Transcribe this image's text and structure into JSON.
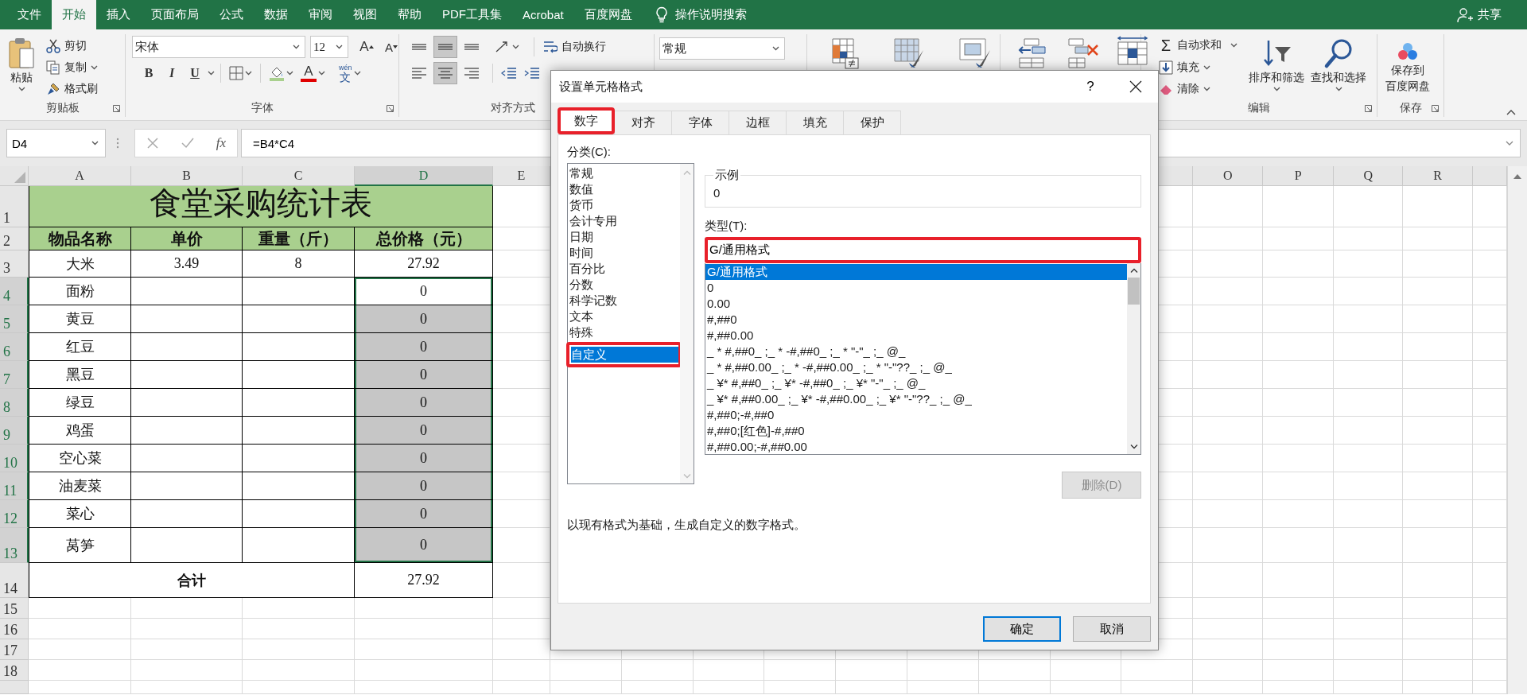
{
  "ribbon_tabs": [
    {
      "label": "文件",
      "selected": false
    },
    {
      "label": "开始",
      "selected": true
    },
    {
      "label": "插入",
      "selected": false
    },
    {
      "label": "页面布局",
      "selected": false
    },
    {
      "label": "公式",
      "selected": false
    },
    {
      "label": "数据",
      "selected": false
    },
    {
      "label": "审阅",
      "selected": false
    },
    {
      "label": "视图",
      "selected": false
    },
    {
      "label": "帮助",
      "selected": false
    },
    {
      "label": "PDF工具集",
      "selected": false
    },
    {
      "label": "Acrobat",
      "selected": false
    },
    {
      "label": "百度网盘",
      "selected": false
    }
  ],
  "tell_me": "操作说明搜索",
  "share": "共享",
  "clipboard": {
    "paste": "粘贴",
    "cut": "剪切",
    "copy": "复制",
    "format_painter": "格式刷",
    "label": "剪贴板"
  },
  "font": {
    "name": "宋体",
    "size": "12",
    "grow": "A",
    "shrink": "A",
    "bold": "B",
    "italic": "I",
    "underline": "U",
    "color_letter": "A",
    "phonetic_top": "wén",
    "phonetic": "文",
    "label": "字体"
  },
  "alignment": {
    "vertical_buttons": [
      {
        "selected": false
      },
      {
        "selected": true
      },
      {
        "selected": false
      }
    ],
    "horizontal_buttons": [
      {
        "selected": false
      },
      {
        "selected": true
      },
      {
        "selected": false
      }
    ],
    "wrap_text": "自动换行",
    "label": "对齐方式"
  },
  "number": {
    "format": "常规"
  },
  "editing": {
    "sigma": "Σ",
    "autosum": "自动求和",
    "fill": "填充",
    "clear": "清除",
    "sort_filter": "排序和筛选",
    "find_select": "查找和选择",
    "label": "编辑"
  },
  "save": {
    "lines": [
      "保存到",
      "百度网盘"
    ],
    "label": "保存"
  },
  "formula_bar": {
    "name_box": "D4",
    "fx": "fx",
    "formula": "=B4*C4"
  },
  "sheet": {
    "column_headers": [
      {
        "label": "A",
        "selected": false
      },
      {
        "label": "B",
        "selected": false
      },
      {
        "label": "C",
        "selected": false
      },
      {
        "label": "D",
        "selected": true
      },
      {
        "label": "E",
        "selected": false
      },
      {
        "label": "O",
        "selected": false
      },
      {
        "label": "P",
        "selected": false
      },
      {
        "label": "Q",
        "selected": false
      },
      {
        "label": "R",
        "selected": false
      }
    ],
    "row_headers": [
      {
        "label": "1",
        "selected": false
      },
      {
        "label": "2",
        "selected": false
      },
      {
        "label": "3",
        "selected": false
      },
      {
        "label": "4",
        "selected": true
      },
      {
        "label": "5",
        "selected": true
      },
      {
        "label": "6",
        "selected": true
      },
      {
        "label": "7",
        "selected": true
      },
      {
        "label": "8",
        "selected": true
      },
      {
        "label": "9",
        "selected": true
      },
      {
        "label": "10",
        "selected": true
      },
      {
        "label": "11",
        "selected": true
      },
      {
        "label": "12",
        "selected": true
      },
      {
        "label": "13",
        "selected": true
      },
      {
        "label": "14",
        "selected": false
      },
      {
        "label": "15",
        "selected": false
      },
      {
        "label": "16",
        "selected": false
      },
      {
        "label": "17",
        "selected": false
      },
      {
        "label": "18",
        "selected": false
      }
    ],
    "title": "食堂采购统计表",
    "header": [
      "物品名称",
      "单价",
      "重量（斤）",
      "总价格（元）"
    ],
    "rows": [
      {
        "item": "大米",
        "price": "3.49",
        "weight": "8",
        "total": "27.92",
        "selected": false,
        "active": false
      },
      {
        "item": "面粉",
        "total": "0",
        "selected": true,
        "active": true
      },
      {
        "item": "黄豆",
        "total": "0",
        "selected": true,
        "active": false
      },
      {
        "item": "红豆",
        "total": "0",
        "selected": true,
        "active": false
      },
      {
        "item": "黑豆",
        "total": "0",
        "selected": true,
        "active": false
      },
      {
        "item": "绿豆",
        "total": "0",
        "selected": true,
        "active": false
      },
      {
        "item": "鸡蛋",
        "total": "0",
        "selected": true,
        "active": false
      },
      {
        "item": "空心菜",
        "total": "0",
        "selected": true,
        "active": false
      },
      {
        "item": "油麦菜",
        "total": "0",
        "selected": true,
        "active": false
      },
      {
        "item": "菜心",
        "total": "0",
        "selected": true,
        "active": false
      },
      {
        "item": "莴笋",
        "total": "0",
        "selected": true,
        "active": false
      }
    ],
    "footer": {
      "label": "合计",
      "total": "27.92"
    }
  },
  "dialog": {
    "title": "设置单元格格式",
    "help": "?",
    "tabs": [
      {
        "label": "数字",
        "selected": true,
        "highlighted": true
      },
      {
        "label": "对齐",
        "selected": false,
        "highlighted": false
      },
      {
        "label": "字体",
        "selected": false,
        "highlighted": false
      },
      {
        "label": "边框",
        "selected": false,
        "highlighted": false
      },
      {
        "label": "填充",
        "selected": false,
        "highlighted": false
      },
      {
        "label": "保护",
        "selected": false,
        "highlighted": false
      }
    ],
    "category_label": "分类(C):",
    "categories": [
      {
        "label": "常规",
        "selected": false,
        "highlighted": false
      },
      {
        "label": "数值",
        "selected": false,
        "highlighted": false
      },
      {
        "label": "货币",
        "selected": false,
        "highlighted": false
      },
      {
        "label": "会计专用",
        "selected": false,
        "highlighted": false
      },
      {
        "label": "日期",
        "selected": false,
        "highlighted": false
      },
      {
        "label": "时间",
        "selected": false,
        "highlighted": false
      },
      {
        "label": "百分比",
        "selected": false,
        "highlighted": false
      },
      {
        "label": "分数",
        "selected": false,
        "highlighted": false
      },
      {
        "label": "科学记数",
        "selected": false,
        "highlighted": false
      },
      {
        "label": "文本",
        "selected": false,
        "highlighted": false
      },
      {
        "label": "特殊",
        "selected": false,
        "highlighted": false
      },
      {
        "label": "自定义",
        "selected": true,
        "highlighted": true
      }
    ],
    "sample_label": "示例",
    "sample_value": "0",
    "type_label": "类型(T):",
    "type_value": "G/通用格式",
    "type_highlighted": true,
    "formats": [
      {
        "label": "G/通用格式",
        "selected": true
      },
      {
        "label": "0",
        "selected": false
      },
      {
        "label": "0.00",
        "selected": false
      },
      {
        "label": "#,##0",
        "selected": false
      },
      {
        "label": "#,##0.00",
        "selected": false
      },
      {
        "label": "_ * #,##0_ ;_ * -#,##0_ ;_ * \"-\"_ ;_ @_",
        "selected": false
      },
      {
        "label": "_ * #,##0.00_ ;_ * -#,##0.00_ ;_ * \"-\"??_ ;_ @_",
        "selected": false
      },
      {
        "label": "_ ¥* #,##0_ ;_ ¥* -#,##0_ ;_ ¥* \"-\"_ ;_ @_",
        "selected": false
      },
      {
        "label": "_ ¥* #,##0.00_ ;_ ¥* -#,##0.00_ ;_ ¥* \"-\"??_ ;_ @_",
        "selected": false
      },
      {
        "label": "#,##0;-#,##0",
        "selected": false
      },
      {
        "label": "#,##0;[红色]-#,##0",
        "selected": false
      },
      {
        "label": "#,##0.00;-#,##0.00",
        "selected": false
      }
    ],
    "delete_button": {
      "label": "删除(D)",
      "disabled": true
    },
    "hint": "以现有格式为基础，生成自定义的数字格式。",
    "ok": "确定",
    "cancel": "取消"
  }
}
